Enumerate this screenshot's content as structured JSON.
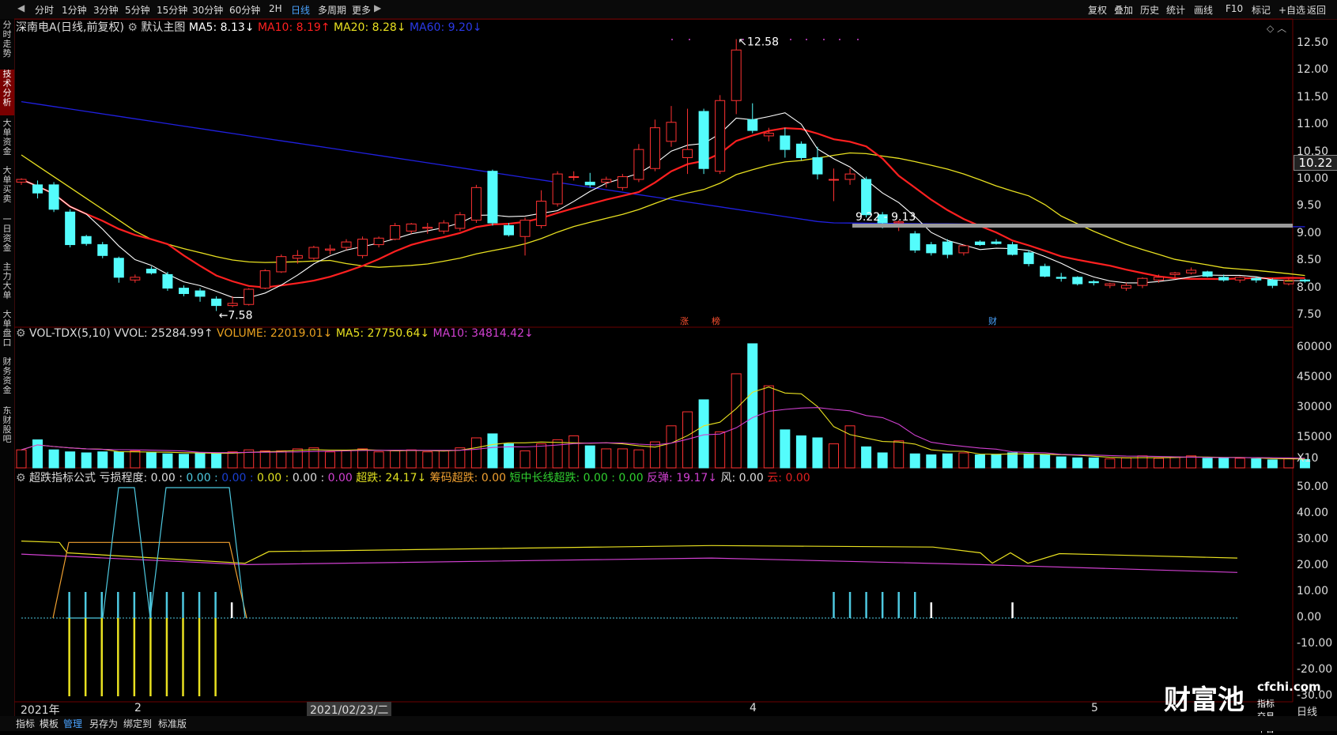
{
  "toolbar": {
    "periods": [
      "分时",
      "1分钟",
      "3分钟",
      "5分钟",
      "15分钟",
      "30分钟",
      "60分钟",
      "2H",
      "日线",
      "多周期",
      "更多"
    ],
    "active_period": "日线",
    "right_items": [
      "复权",
      "叠加",
      "历史",
      "统计",
      "画线",
      "F10",
      "标记",
      "+自选",
      "返回"
    ]
  },
  "sidebar": {
    "tabs": [
      "分时走势",
      "技术分析",
      "大单资金",
      "大单买卖",
      "一日资金",
      "主力大单",
      "大单盘口",
      "财务资金",
      "东财股吧"
    ],
    "active": "技术分析"
  },
  "main_chart": {
    "stock_title": "深南电A(日线,前复权)",
    "template_label": "默认主图",
    "ma5": "MA5: 8.13↓",
    "ma10": "MA10: 8.19↑",
    "ma20": "MA20: 8.28↓",
    "ma60": "MA60: 9.20↓",
    "high_label": "12.58",
    "low_label": "7.58",
    "range_label": "9.22 - 9.13",
    "current_price": "10.22",
    "markers": [
      "涨",
      "榜",
      "财"
    ],
    "y_ticks": [
      "12.50",
      "12.00",
      "11.50",
      "11.00",
      "10.50",
      "10.00",
      "9.50",
      "9.00",
      "8.50",
      "8.00",
      "7.50"
    ]
  },
  "volume_chart": {
    "title": "VOL-TDX(5,10) VVOL: 25284.99↑",
    "volume": "VOLUME: 22019.01↓",
    "ma5": "MA5: 27750.64↓",
    "ma10": "MA10: 34814.42↓",
    "y_ticks": [
      "60000",
      "45000",
      "30000",
      "15000",
      "X10"
    ]
  },
  "indicator_chart": {
    "name": "超跌指标公式",
    "values": [
      {
        "text": "亏损程度: 0.00 :",
        "color": "#dddddd"
      },
      {
        "text": "0.00 :",
        "color": "#4ec9e0"
      },
      {
        "text": "0.00 :",
        "color": "#1a3fd0"
      },
      {
        "text": "0.00 :",
        "color": "#e0e020"
      },
      {
        "text": "0.00 :",
        "color": "#dddddd"
      },
      {
        "text": "0.00",
        "color": "#d040d0"
      },
      {
        "text": "超跌: 24.17↓",
        "color": "#e0e020"
      },
      {
        "text": "筹码超跌: 0.00",
        "color": "#f0a030"
      },
      {
        "text": "短中长线超跌: 0.00 : 0.00",
        "color": "#30d030"
      },
      {
        "text": "反弹: 19.17↓",
        "color": "#d040d0"
      },
      {
        "text": "风: 0.00",
        "color": "#dddddd"
      },
      {
        "text": "云: 0.00",
        "color": "#e02020"
      }
    ],
    "y_ticks": [
      "50.00",
      "40.00",
      "30.00",
      "20.00",
      "10.00",
      "0.00",
      "-10.00",
      "-20.00",
      "-30.00"
    ]
  },
  "x_axis": {
    "labels": [
      "2021年",
      "2",
      "2021/02/23/二",
      "4",
      "5"
    ],
    "period": "日线"
  },
  "watermark": {
    "logo_text": "财富池",
    "site": "cfchi.com",
    "tagline": "指标交易平台"
  },
  "bottombar": {
    "items": [
      "指标",
      "模板",
      "管理",
      "另存为",
      "绑定到",
      "标准版"
    ],
    "active": "管理"
  },
  "colors": {
    "up": "#ff3232",
    "down": "#54fcfc",
    "ma5": "#ffffff",
    "ma10": "#ff2020",
    "ma20": "#e8e020",
    "ma60": "#2020e0",
    "vol_ma5": "#e8e020",
    "vol_ma10": "#d040d0"
  }
}
